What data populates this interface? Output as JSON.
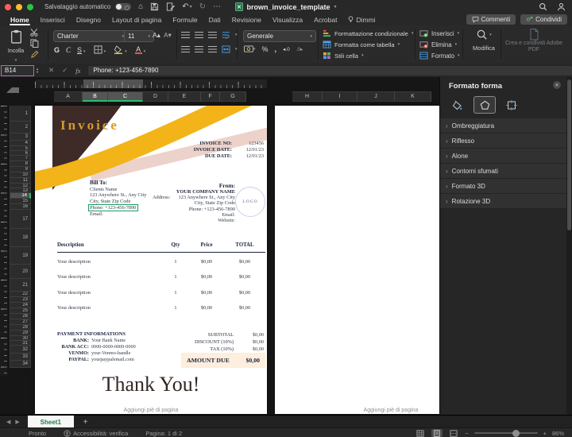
{
  "icons": {
    "chevron_down": "▾",
    "chevron_right": "›",
    "ellipsis": "⋯",
    "undo": "↶",
    "redo": "↻",
    "home": "⌂",
    "close": "✕",
    "cancel": "✕",
    "confirm": "✓",
    "fx": "fx",
    "prev": "◀",
    "next": "▶",
    "add_sheet": "+",
    "zoom_out": "−",
    "zoom_in": "+",
    "percent": "%",
    "comma": ",",
    "decimal_dec": "◂.0",
    "decimal_inc": ".0▸",
    "increase_font": "A▴",
    "decrease_font": "A▾",
    "stepper_up": "▲",
    "stepper_down": "▼",
    "font_color": "A"
  },
  "titlebar": {
    "autosave_label": "Salvataggio automatico",
    "filename": "brown_invoice_template"
  },
  "tabs": [
    {
      "label": "Home",
      "active": true
    },
    {
      "label": "Inserisci"
    },
    {
      "label": "Disegno"
    },
    {
      "label": "Layout di pagina"
    },
    {
      "label": "Formule"
    },
    {
      "label": "Dati"
    },
    {
      "label": "Revisione"
    },
    {
      "label": "Visualizza"
    },
    {
      "label": "Acrobat"
    },
    {
      "label": "Dimmi"
    }
  ],
  "actions": {
    "comments": "Commenti",
    "share": "Condividi"
  },
  "ribbon": {
    "paste_label": "Incolla",
    "font": {
      "name": "Charter",
      "size": "11",
      "bold": "G",
      "italic": "C",
      "underline": "S"
    },
    "number_format": "Generale",
    "styles": [
      "Formattazione condizionale",
      "Formatta come tabella",
      "Stili cella"
    ],
    "cells": [
      "Inserisci",
      "Elimina",
      "Formato"
    ],
    "edit_label": "Modifica",
    "adobe_label": "Crea e condividi Adobe PDF"
  },
  "formula_bar": {
    "name_box": "B14",
    "value": "Phone: +123-456-7890"
  },
  "grid": {
    "columns_page1": [
      "A",
      "B",
      "C",
      "D",
      "E",
      "F",
      "G"
    ],
    "columns_page2": [
      "H",
      "I",
      "J",
      "K"
    ],
    "selected_columns": [
      "B",
      "C"
    ],
    "row_start": 1,
    "row_end": 34,
    "selected_row": 14
  },
  "invoice": {
    "title": "Invoice",
    "meta": [
      {
        "label": "INVOICE NO:",
        "value": "123456"
      },
      {
        "label": "INVOICE DATE:",
        "value": "12/01/23"
      },
      {
        "label": "DUE DATE:",
        "value": "12/01/23"
      }
    ],
    "bill_to": {
      "title": "Bill To:",
      "lines": [
        "Clients Name",
        "123 Anywhere St., Any City",
        "City, State Zip Code"
      ],
      "phone": "Phone: +123-456-7890",
      "email": "Email:"
    },
    "from": {
      "title": "From:",
      "company": "YOUR COMPANY NAME",
      "address_label": "Address:",
      "lines": [
        "123 Anywhere St., Any City",
        "City, State Zip Code",
        "Phone: +123-456-7890",
        "Email:",
        "Website:"
      ]
    },
    "logo_text": "LOGO",
    "table": {
      "headers": [
        "Description",
        "Qty",
        "Price",
        "TOTAL"
      ],
      "rows": [
        [
          "Your description",
          "1",
          "$0,00",
          "$0,00"
        ],
        [
          "Your description",
          "1",
          "$0,00",
          "$0,00"
        ],
        [
          "Your description",
          "1",
          "$0,00",
          "$0,00"
        ],
        [
          "Your description",
          "1",
          "$0,00",
          "$0,00"
        ]
      ]
    },
    "payment": {
      "title": "PAYMENT INFORMATIONS",
      "fields": [
        {
          "label": "BANK:",
          "value": "Your Bank Name"
        },
        {
          "label": "BANK ACC:",
          "value": "0000-0000-0000-0000"
        },
        {
          "label": "VENMO:",
          "value": "your-Venmo-handle"
        },
        {
          "label": "PAYPAL:",
          "value": "yourpaypalemail.com"
        }
      ]
    },
    "totals": [
      {
        "label": "SUBTOTAL",
        "value": "$0,00"
      },
      {
        "label": "DISCOUNT (10%)",
        "value": "$0,00"
      },
      {
        "label": "TAX (10%)",
        "value": "$0,00"
      }
    ],
    "amount_due": {
      "label": "AMOUNT DUE",
      "value": "$0,00"
    },
    "thank_you": "Thank You!",
    "footer_placeholder": "Aggiungi piè di pagina"
  },
  "format_panel": {
    "title": "Formato forma",
    "sections": [
      "Ombreggiatura",
      "Riflesso",
      "Alone",
      "Contorni sfumati",
      "Formato 3D",
      "Rotazione 3D"
    ]
  },
  "sheet_bar": {
    "active_sheet": "Sheet1"
  },
  "status_bar": {
    "ready": "Pronto",
    "accessibility": "Accessibilità: verifica",
    "page": "Pagina: 1 di 2",
    "zoom": "86%"
  },
  "colors": {
    "accent_green": "#17a05c",
    "gold": "#f2b418",
    "brown": "#3e2b27",
    "pink": "#ecd2cb",
    "invoice_gold_text": "#d49b28",
    "amount_due_bg": "#fdeedd",
    "namebox_border": "#b66bb6"
  }
}
